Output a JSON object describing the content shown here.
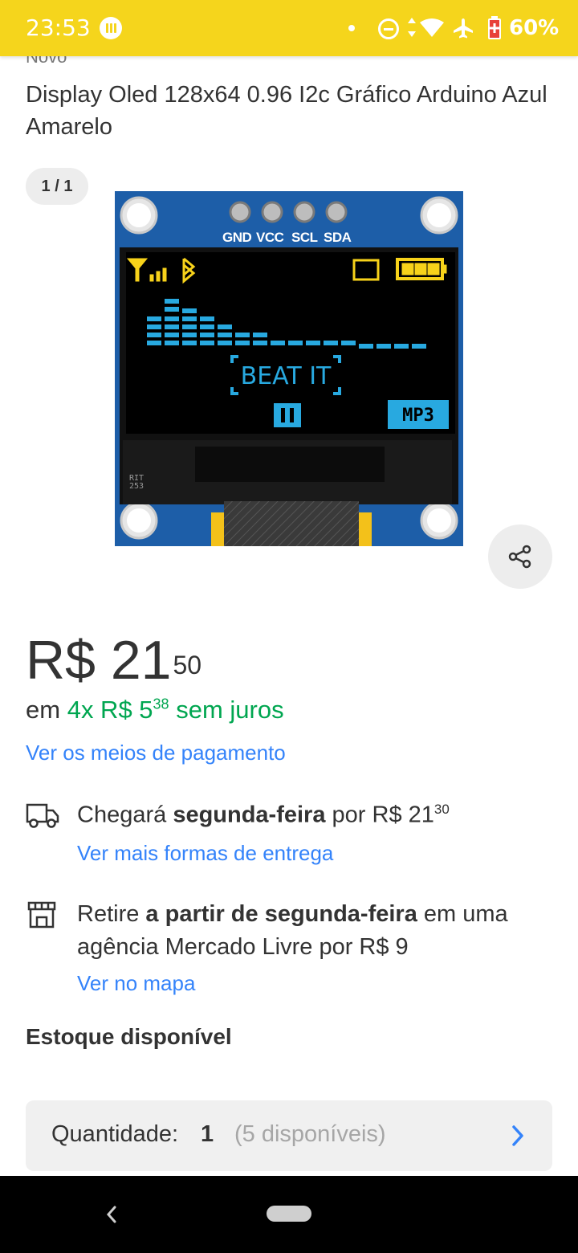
{
  "status_bar": {
    "time": "23:53",
    "battery": "60%",
    "icons": [
      "app-notification-icon",
      "dot-icon",
      "do-not-disturb-icon",
      "data-arrows-icon",
      "wifi-icon",
      "airplane-icon",
      "battery-icon"
    ]
  },
  "product": {
    "condition": "Novo",
    "title": "Display Oled 128x64 0.96 I2c Gráfico Arduino Azul Amarelo",
    "image_counter": "1 / 1",
    "image_pins": [
      "GND",
      "VCC",
      "SCL",
      "SDA"
    ],
    "image_screen_text": "BEAT IT",
    "image_mode_text": "MP3",
    "image_chip_text": "RIT 253"
  },
  "price": {
    "currency": "R$",
    "integer": "21",
    "cents": "50"
  },
  "installments": {
    "prefix": "em",
    "count": "4x R$ 5",
    "cents": "38",
    "suffix": "sem juros"
  },
  "payment_link": "Ver os meios de pagamento",
  "shipping": {
    "prefix": "Chegará",
    "day": "segunda-feira",
    "price_text": "por R$ 21",
    "price_cents": "30",
    "link": "Ver mais formas de entrega"
  },
  "pickup": {
    "prefix": "Retire",
    "bold": "a partir de segunda-feira",
    "suffix": "em uma agência Mercado Livre por R$ 9",
    "link": "Ver no mapa"
  },
  "stock_label": "Estoque disponível",
  "quantity": {
    "label": "Quantidade:",
    "value": "1",
    "available": "(5 disponíveis)"
  },
  "colors": {
    "status_bar": "#f5d51c",
    "link": "#3483fa",
    "green": "#00a650",
    "text": "#333333",
    "oled_blue": "#28a9e0",
    "oled_yellow": "#f7d21a",
    "pcb_blue": "#1d5ea8"
  }
}
